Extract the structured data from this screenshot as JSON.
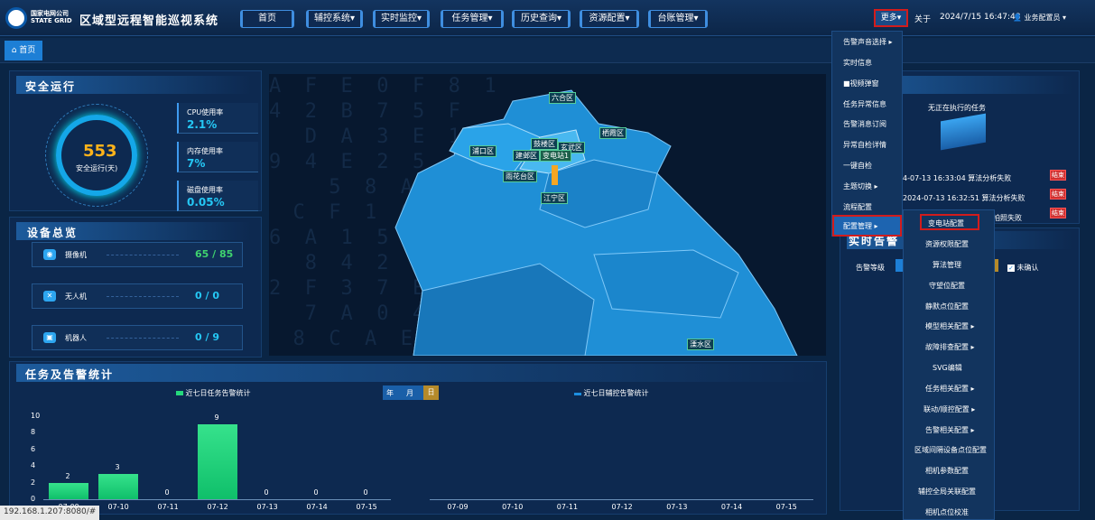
{
  "header": {
    "org_line1": "国家电网公司",
    "org_line2": "STATE GRID",
    "system_title": "区域型远程智能巡视系统",
    "nav": [
      "首页",
      "辅控系统▾",
      "实时监控▾",
      "任务管理▾",
      "历史查询▾",
      "资源配置▾",
      "台账管理▾"
    ],
    "more": "更多▾",
    "about": "关于",
    "datetime": "2024/7/15 16:47:48",
    "user": "业务配置员 ▾"
  },
  "breadcrumb": {
    "home": "首页"
  },
  "safety": {
    "title": "安全运行",
    "days_value": "553",
    "days_label": "安全运行(天)",
    "stats": [
      {
        "label": "CPU使用率",
        "value": "2.1%"
      },
      {
        "label": "内存使用率",
        "value": "7%"
      },
      {
        "label": "磁盘使用率",
        "value": "0.05%"
      }
    ]
  },
  "devices": {
    "title": "设备总览",
    "items": [
      {
        "icon": "camera-icon",
        "glyph": "◉",
        "label": "摄像机",
        "value": "65 / 85"
      },
      {
        "icon": "drone-icon",
        "glyph": "✕",
        "label": "无人机",
        "value": "0 / 0"
      },
      {
        "icon": "robot-icon",
        "glyph": "▣",
        "label": "机器人",
        "value": "0 / 9"
      }
    ]
  },
  "map": {
    "labels": [
      "六合区",
      "栖霞区",
      "鼓楼区",
      "玄武区",
      "浦口区",
      "建邺区",
      "变电站1",
      "雨花台区",
      "江宁区",
      "溧水区"
    ],
    "bg_text": "A  F  E  0  F  8  1\n4  2  B  7  5  F\n   D  A  3  E  1\n9  4  E  2  5  C  7\n     5  8  A  3\n  C  F  1  0  E  4\n6  A  1  5  F  6  0\n   8  4  2  0  C  4\n2  F  3  7  E  9\n   7  A  0  4  6\n  8  C  A  E  5"
  },
  "task": {
    "no_task": "无正在执行的任务",
    "records": [
      {
        "time": "4-07-13 16:33:04",
        "text": "算法分析失败",
        "btn": "结束"
      },
      {
        "time": "2024-07-13 16:32:51",
        "text": "算法分析失败",
        "btn": "结束"
      },
      {
        "time": "",
        "text": "拍照失败",
        "btn": "结束"
      }
    ]
  },
  "alarm": {
    "title": "实时告警",
    "level_label": "告警等级",
    "unconfirmed": "未确认"
  },
  "stats": {
    "title": "任务及告警统计",
    "left_legend": "近七日任务告警统计",
    "right_legend": "近七日辅控告警统计",
    "period_buttons": [
      "年",
      "月",
      "日"
    ],
    "active_period": "日"
  },
  "menu": {
    "level1": [
      "告警声音选择 ▸",
      "实时信息",
      "■视频弹窗",
      "任务异常信息",
      "告警消息订阅",
      "异常自检详情",
      "一键自检",
      "主题切换 ▸",
      "流程配置",
      "配置管理 ▸"
    ],
    "level2": [
      "变电站配置",
      "资源权限配置",
      "算法管理",
      "守望位配置",
      "静默点位配置",
      "模型相关配置 ▸",
      "故障排查配置 ▸",
      "SVG编辑",
      "任务相关配置 ▸",
      "联动/顺控配置 ▸",
      "告警相关配置 ▸",
      "区域间隔设备点位配置",
      "相机参数配置",
      "辅控全局关联配置",
      "相机点位校准"
    ]
  },
  "status_url": "192.168.1.207:8080/#",
  "chart_data": [
    {
      "type": "bar",
      "title": "近七日任务告警统计",
      "categories": [
        "07-09",
        "07-10",
        "07-11",
        "07-12",
        "07-13",
        "07-14",
        "07-15"
      ],
      "values": [
        2,
        3,
        0,
        9,
        0,
        0,
        0
      ],
      "ylim": [
        0,
        10
      ],
      "yticks": [
        0,
        2,
        4,
        6,
        8,
        10
      ],
      "color": "#25d97c"
    },
    {
      "type": "bar",
      "title": "近七日辅控告警统计",
      "categories": [
        "07-09",
        "07-10",
        "07-11",
        "07-12",
        "07-13",
        "07-14",
        "07-15"
      ],
      "values": [],
      "color": "#1d8fe0"
    }
  ]
}
